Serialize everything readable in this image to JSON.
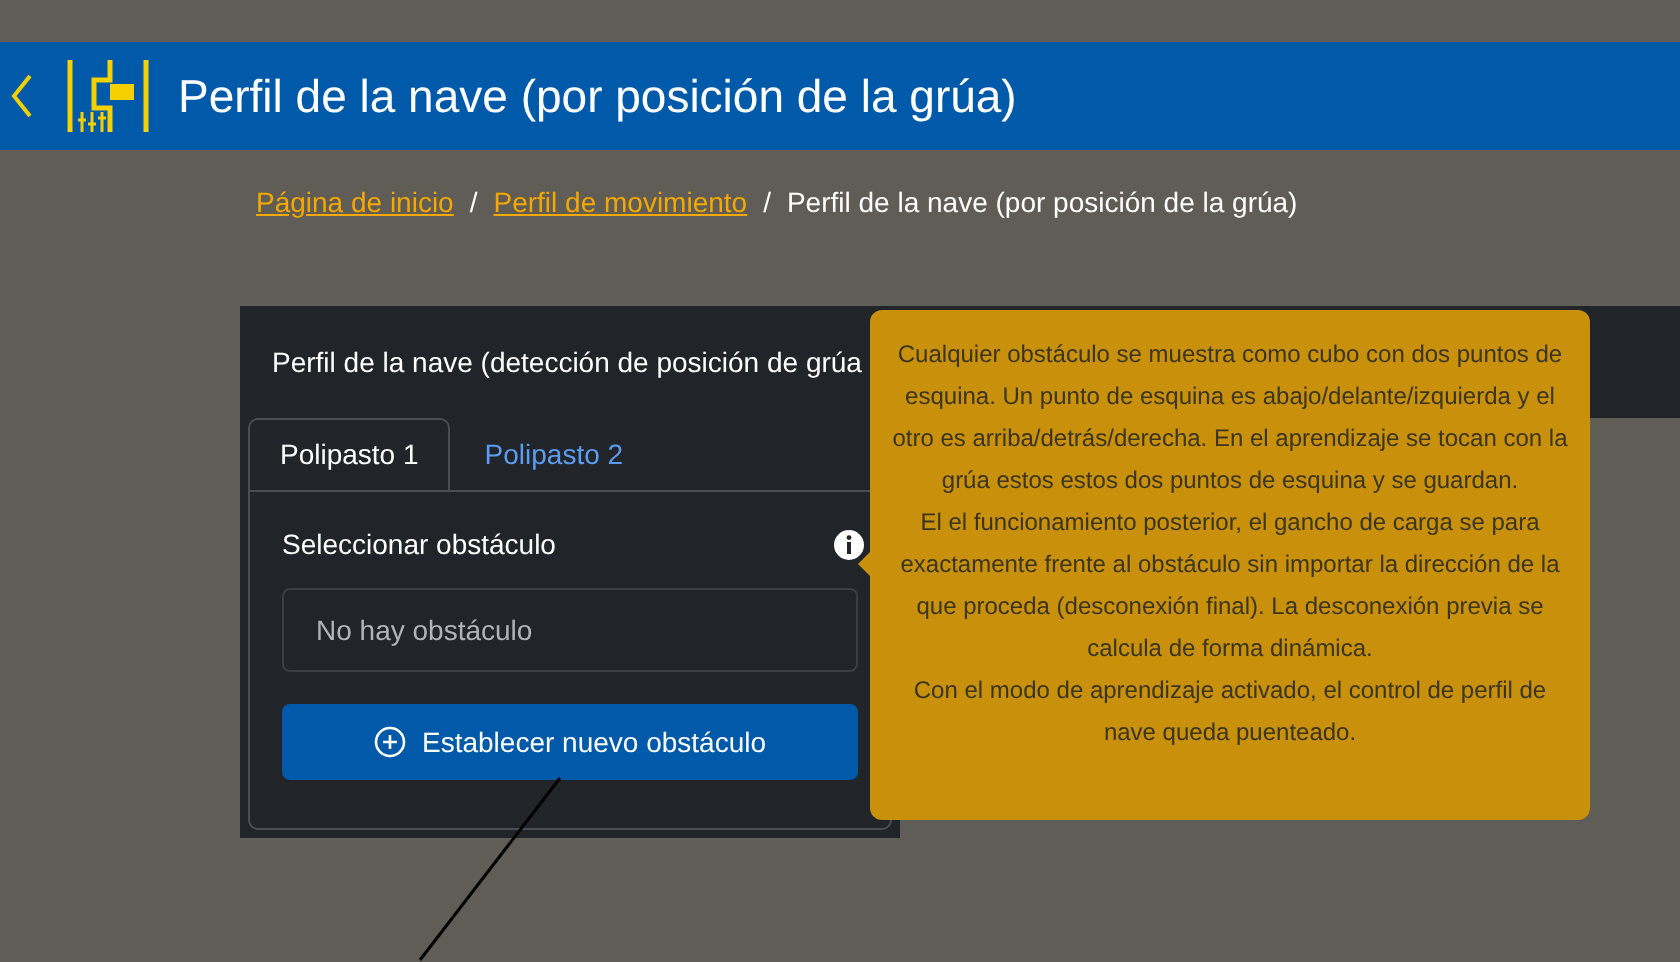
{
  "header": {
    "title": "Perfil de la nave (por posición de la grúa)"
  },
  "breadcrumb": [
    {
      "label": "Página de inicio",
      "kind": "link"
    },
    {
      "label": "/",
      "kind": "separator"
    },
    {
      "label": "Perfil de movimiento",
      "kind": "link"
    },
    {
      "label": "/",
      "kind": "separator"
    },
    {
      "label": "Perfil de la nave (por posición de la grúa)",
      "kind": "current"
    }
  ],
  "card": {
    "title": "Perfil de la nave (detección de posición de grúa",
    "tabs": [
      {
        "label": "Polipasto 1",
        "selected": true
      },
      {
        "label": "Polipasto 2",
        "selected": false
      }
    ],
    "field_label": "Seleccionar obstáculo",
    "select": {
      "value": "No hay obstáculo"
    },
    "button": "Establecer nuevo obstáculo"
  },
  "tooltip": {
    "paragraphs": [
      "Cualquier obstáculo se muestra como cubo con dos puntos de esquina. Un punto de esquina es abajo/delante/izquierda y el otro es arriba/detrás/derecha. En el aprendizaje se tocan con la grúa estos estos dos puntos de esquina y se guardan.",
      "El el funcionamiento posterior, el gancho de carga se para exactamente frente al obstáculo sin importar la dirección de la que proceda (desconexión final). La desconexión previa se calcula de forma dinámica.",
      "Con el modo de aprendizaje activado, el control de perfil de nave queda puenteado."
    ]
  }
}
